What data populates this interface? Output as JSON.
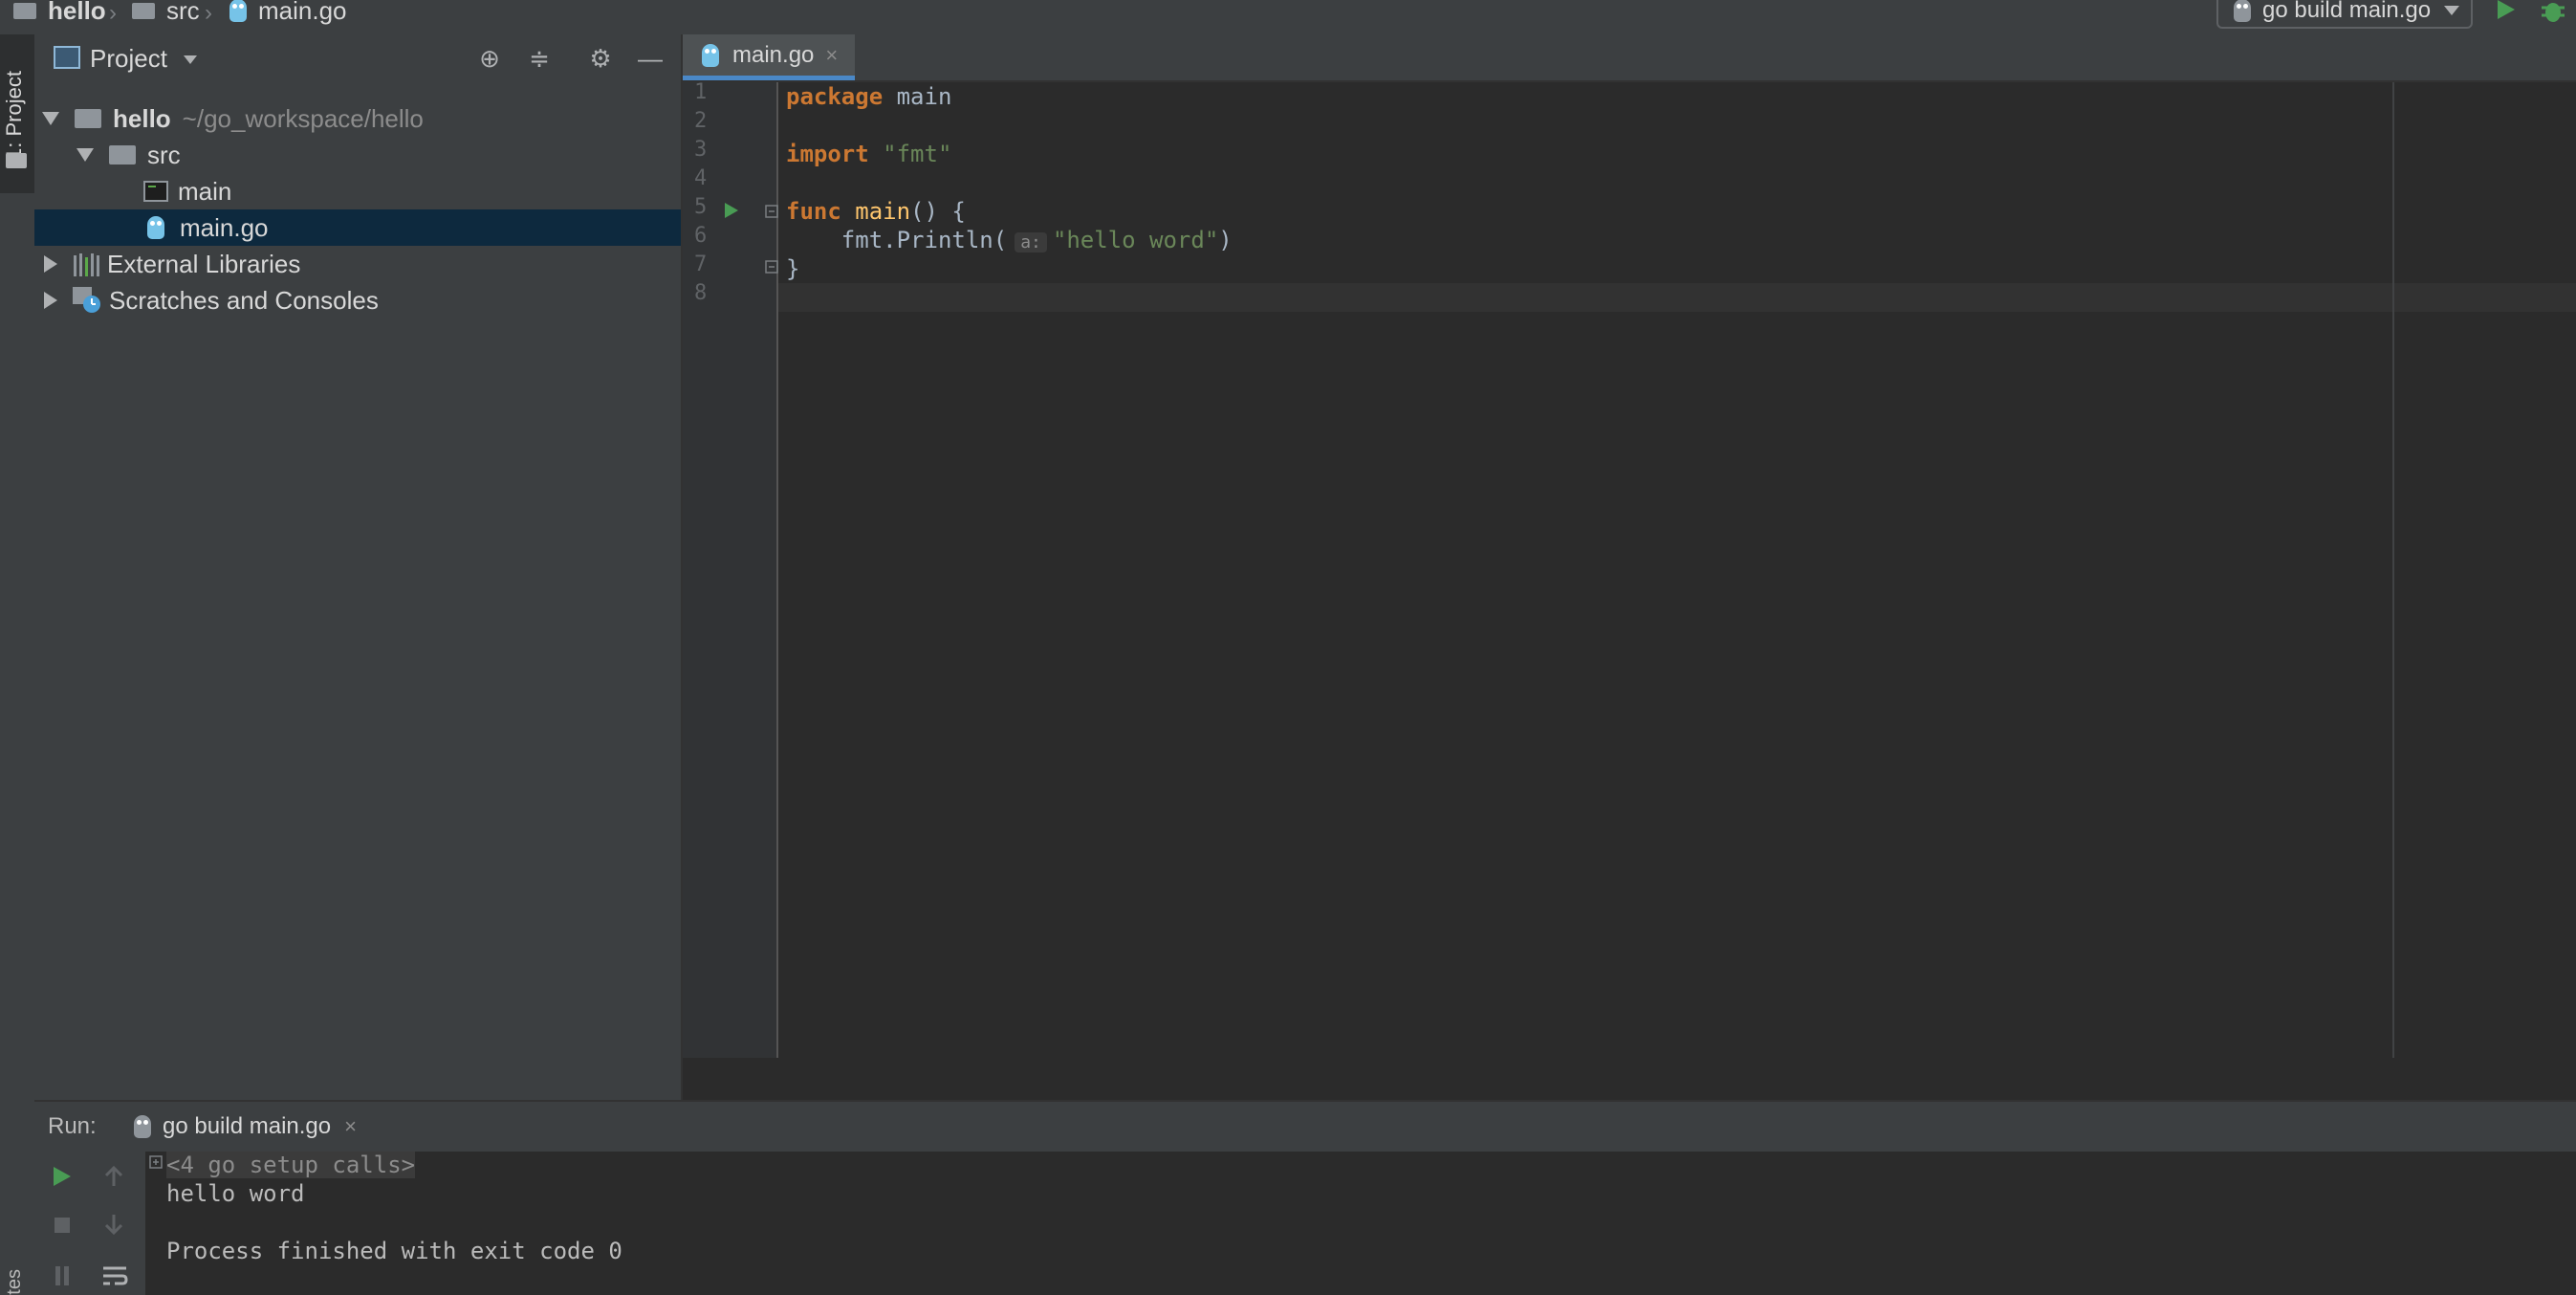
{
  "breadcrumb": {
    "project": "hello",
    "folder": "src",
    "file": "main.go"
  },
  "run_config": {
    "label": "go build main.go"
  },
  "left_stripe": {
    "project_tab": "1: Project",
    "bottom_tab_fragment": "tes"
  },
  "project_panel": {
    "title": "Project",
    "tree": [
      {
        "label": "hello",
        "path": "~/go_workspace/hello",
        "icon": "folder-icon",
        "expanded": true
      },
      {
        "label": "src",
        "icon": "folder-icon",
        "expanded": true
      },
      {
        "label": "main",
        "icon": "executable-icon"
      },
      {
        "label": "main.go",
        "icon": "go-file-icon",
        "selected": true
      },
      {
        "label": "External Libraries",
        "icon": "libraries-icon",
        "expanded": false
      },
      {
        "label": "Scratches and Consoles",
        "icon": "scratches-icon",
        "expanded": false
      }
    ]
  },
  "editor": {
    "tab_label": "main.go",
    "line_numbers": [
      "1",
      "2",
      "3",
      "4",
      "5",
      "6",
      "7",
      "8"
    ],
    "code": {
      "line1_kw": "package",
      "line1_rest": " main",
      "line3_kw": "import",
      "line3_str": "\"fmt\"",
      "line5_kw": "func",
      "line5_fn": "main",
      "line5_rest": "() {",
      "line6_call": "    fmt.Println(",
      "line6_hint": "a:",
      "line6_str": "\"hello word\"",
      "line6_end": ")",
      "line7": "}"
    }
  },
  "run_panel": {
    "label": "Run:",
    "tab_label": "go build main.go",
    "console": {
      "setup_calls": "<4 go setup calls>",
      "output": "hello word",
      "exit_message": "Process finished with exit code 0"
    }
  },
  "colors": {
    "keyword": "#cc7832",
    "function": "#ffc66d",
    "string": "#6a8759",
    "selection": "#0d293e",
    "run_green": "#499c54"
  }
}
